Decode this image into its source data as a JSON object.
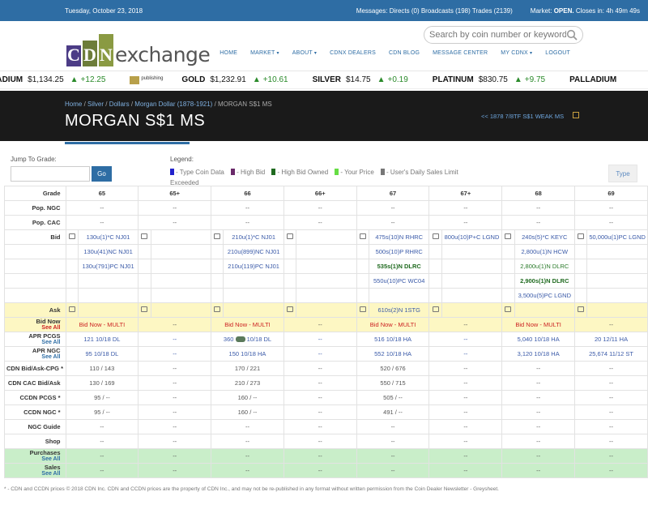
{
  "topbar": {
    "date": "Tuesday, October 23, 2018",
    "messages_label": "Messages:",
    "directs": "Directs (0)",
    "broadcasts": "Broadcasts (198)",
    "trades": "Trades (2139)",
    "market_label": "Market:",
    "market_status": "OPEN.",
    "market_closes": "Closes in: 4h 49m 49s"
  },
  "logo": {
    "l1": "C",
    "l2": "D",
    "l3": "N",
    "word": "exchange"
  },
  "search": {
    "placeholder": "Search by coin number or keyword"
  },
  "nav": [
    "HOME",
    "MARKET",
    "ABOUT",
    "CDNX DEALERS",
    "CDN BLOG",
    "MESSAGE CENTER",
    "MY CDNX",
    "LOGOUT"
  ],
  "ticker": [
    {
      "name": "PALLADIUM",
      "price": "$1,134.25",
      "change": "+12.25"
    },
    {
      "name": "GOLD",
      "price": "$1,232.91",
      "change": "+10.61"
    },
    {
      "name": "SILVER",
      "price": "$14.75",
      "change": "+0.19"
    },
    {
      "name": "PLATINUM",
      "price": "$830.75",
      "change": "+9.75"
    },
    {
      "name": "PALLADIUM",
      "price": "",
      "change": ""
    }
  ],
  "ticker_logo": "publishing",
  "breadcrumb": [
    "Home",
    "Silver",
    "Dollars",
    "Morgan Dollar (1878-1921)",
    "MORGAN S$1 MS"
  ],
  "page_title": "MORGAN S$1 MS",
  "prev_link": "<< 1878 7/8TF S$1 WEAK MS",
  "jump": {
    "label": "Jump To Grade:",
    "go": "Go"
  },
  "legend": {
    "title": "Legend:",
    "items": [
      {
        "text": "- Type Coin Data",
        "color": "#2222cc"
      },
      {
        "text": "- High Bid",
        "color": "#6a2a6a"
      },
      {
        "text": "- High Bid Owned",
        "color": "#1f6a1f"
      },
      {
        "text": "- Your Price",
        "color": "#66dd44"
      },
      {
        "text": "- User's Daily Sales Limit Exceeded",
        "color": "#777777"
      }
    ]
  },
  "type_button": "Type",
  "table": {
    "grades": [
      "Grade",
      "65",
      "65+",
      "66",
      "66+",
      "67",
      "67+",
      "68",
      "69"
    ],
    "pop_ngc": [
      "Pop. NGC",
      "--",
      "--",
      "--",
      "--",
      "--",
      "--",
      "--",
      "--"
    ],
    "pop_cac": [
      "Pop. CAC",
      "--",
      "--",
      "--",
      "--",
      "--",
      "--",
      "--",
      "--"
    ],
    "bid_label": "Bid",
    "bids": [
      [
        "130u(1)*C NJ01",
        "",
        "210u(1)*C NJ01",
        "",
        "475s(10)N RHRC",
        "800u(10)P+C LGND",
        "240s(5)*C KEYC",
        "50,000u(1)PC LGND"
      ],
      [
        "130u(41)NC NJ01",
        "",
        "210u(899)NC NJ01",
        "",
        "500s(10)P RHRC",
        "",
        "2,800u(1)N HCW",
        ""
      ],
      [
        "130u(791)PC NJ01",
        "",
        "210u(119)PC NJ01",
        "",
        "535s(1)N DLRC",
        "",
        "2,800u(1)N DLRC",
        ""
      ],
      [
        "",
        "",
        "",
        "",
        "550u(10)PC WC04",
        "",
        "2,900s(1)N DLRC",
        ""
      ],
      [
        "",
        "",
        "",
        "",
        "",
        "",
        "3,500u(5)PC LGND",
        ""
      ]
    ],
    "ask": [
      "Ask",
      "",
      "",
      "",
      "",
      "610s(2)N 1STG",
      "",
      "",
      ""
    ],
    "bid_now_label": "Bid Now",
    "see_all": "See All",
    "bid_now": [
      "Bid Now - MULTI",
      "--",
      "Bid Now - MULTI",
      "--",
      "Bid Now - MULTI",
      "--",
      "Bid Now - MULTI",
      "--"
    ],
    "apr_pcgs_label": "APR PCGS",
    "apr_pcgs": [
      "121 10/18 DL",
      "--",
      "360 10/18 DL",
      "--",
      "516 10/18 HA",
      "--",
      "5,040 10/18 HA",
      "20 12/11 HA"
    ],
    "apr_ngc_label": "APR NGC",
    "apr_ngc": [
      "95 10/18 DL",
      "--",
      "150 10/18 HA",
      "--",
      "552 10/18 HA",
      "--",
      "3,120 10/18 HA",
      "25,674 11/12 ST"
    ],
    "cdn_cpg": [
      "CDN Bid/Ask-CPG *",
      "110 / 143",
      "--",
      "170 / 221",
      "--",
      "520 / 676",
      "--",
      "--",
      "--"
    ],
    "cdn_cac": [
      "CDN CAC Bid/Ask",
      "130 / 169",
      "--",
      "210 / 273",
      "--",
      "550 / 715",
      "--",
      "--",
      "--"
    ],
    "ccdn_pcgs": [
      "CCDN PCGS *",
      "95 / --",
      "--",
      "160 / --",
      "--",
      "505 / --",
      "--",
      "--",
      "--"
    ],
    "ccdn_ngc": [
      "CCDN NGC *",
      "95 / --",
      "--",
      "160 / --",
      "--",
      "491 / --",
      "--",
      "--",
      "--"
    ],
    "ngc_guide": [
      "NGC Guide",
      "--",
      "--",
      "--",
      "--",
      "--",
      "--",
      "--",
      "--"
    ],
    "shop": [
      "Shop",
      "--",
      "--",
      "--",
      "--",
      "--",
      "--",
      "--",
      "--"
    ],
    "purchases_label": "Purchases",
    "purchases": [
      "--",
      "--",
      "--",
      "--",
      "--",
      "--",
      "--",
      "--"
    ],
    "sales_label": "Sales",
    "sales": [
      "--",
      "--",
      "--",
      "--",
      "--",
      "--",
      "--",
      "--"
    ]
  },
  "footer": "* - CDN and CCDN prices © 2018 CDN Inc. CDN and CCDN prices are the property of CDN Inc., and may not be re-published in any format without written permission from the Coin Dealer Newsletter - Greysheet."
}
